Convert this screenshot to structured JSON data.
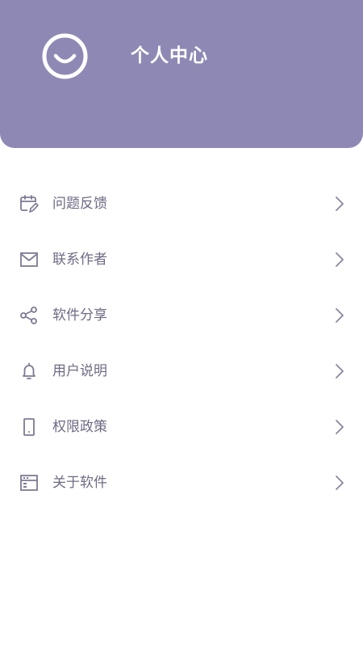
{
  "header": {
    "title": "个人中心",
    "avatar_icon": "smiley-face-icon",
    "background_color": "#8e89b4"
  },
  "menu": {
    "items": [
      {
        "label": "问题反馈",
        "icon": "calendar-edit-icon"
      },
      {
        "label": "联系作者",
        "icon": "mail-icon"
      },
      {
        "label": "软件分享",
        "icon": "share-icon"
      },
      {
        "label": "用户说明",
        "icon": "bell-icon"
      },
      {
        "label": "权限政策",
        "icon": "phone-icon"
      },
      {
        "label": "关于软件",
        "icon": "browser-window-icon"
      }
    ],
    "icon_color": "#7d7a94",
    "text_color": "#6e6b84",
    "chevron_color": "#8a879c"
  }
}
